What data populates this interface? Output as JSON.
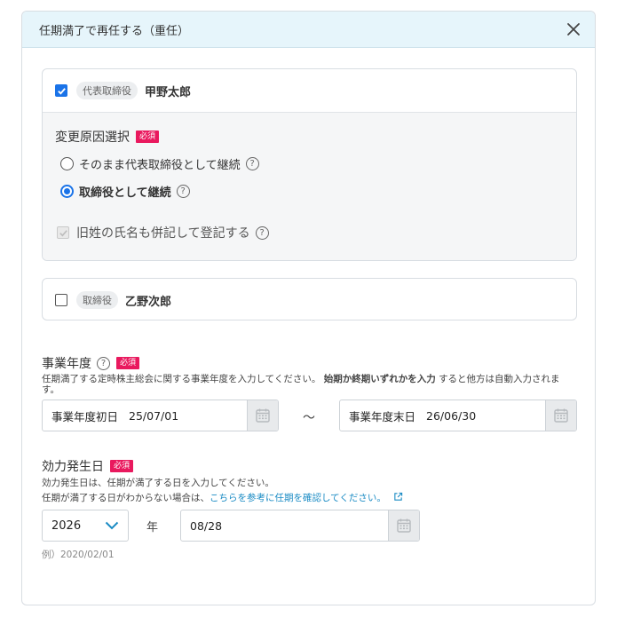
{
  "modal": {
    "title": "任期満了で再任する（重任）"
  },
  "officers": [
    {
      "checked": true,
      "role": "代表取締役",
      "name": "甲野太郎",
      "change_reason": {
        "label": "変更原因選択",
        "required": "必須",
        "options": [
          {
            "label": "そのまま代表取締役として継続",
            "selected": false
          },
          {
            "label": "取締役として継続",
            "selected": true
          }
        ],
        "old_name_label": "旧姓の氏名も併記して登記する"
      }
    },
    {
      "checked": false,
      "role": "取締役",
      "name": "乙野次郎"
    }
  ],
  "fiscal_year": {
    "title": "事業年度",
    "required": "必須",
    "desc_pre": "任期満了する定時株主総会に関する事業年度を入力してください。",
    "desc_bold": "始期か終期いずれかを入力",
    "desc_post": "すると他方は自動入力されます。",
    "start_label": "事業年度初日",
    "start_value": "25/07/01",
    "separator": "～",
    "end_label": "事業年度末日",
    "end_value": "26/06/30"
  },
  "effective_date": {
    "title": "効力発生日",
    "required": "必須",
    "desc_line1": "効力発生日は、任期が満了する日を入力してください。",
    "desc_line2_pre": "任期が満了する日がわからない場合は、",
    "desc_line2_link": "こちらを参考に任期を確認してください。",
    "year_value": "2026",
    "year_suffix": "年",
    "date_value": "08/28",
    "example": "例）2020/02/01"
  },
  "colors": {
    "accent": "#1a73e8",
    "required_badge": "#e9195e",
    "header_bg": "#e6f5fb",
    "link": "#1a8bc4",
    "chevron": "#1a8bc4"
  }
}
